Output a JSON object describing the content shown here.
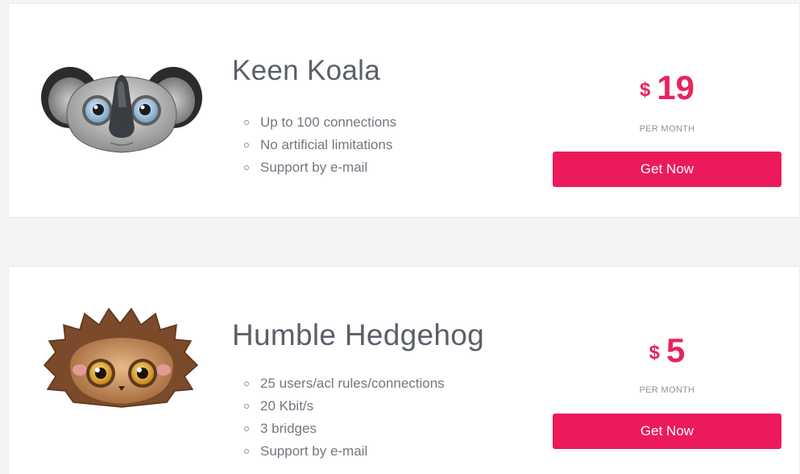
{
  "plans": [
    {
      "name": "Keen Koala",
      "features": [
        "Up to 100 connections",
        "No artificial limitations",
        "Support by e-mail"
      ],
      "currency": "$",
      "price": "19",
      "period": "PER MONTH",
      "button_label": "Get Now",
      "avatar_icon": "koala-icon"
    },
    {
      "name": "Humble Hedgehog",
      "features": [
        "25 users/acl rules/connections",
        "20 Kbit/s",
        "3 bridges",
        "Support by e-mail"
      ],
      "currency": "$",
      "price": "5",
      "period": "PER MONTH",
      "button_label": "Get Now",
      "avatar_icon": "hedgehog-icon"
    }
  ],
  "colors": {
    "accent": "#ec1a5b",
    "price_text": "#e8245c",
    "title_text": "#5b5f69",
    "feature_text": "#737780"
  }
}
